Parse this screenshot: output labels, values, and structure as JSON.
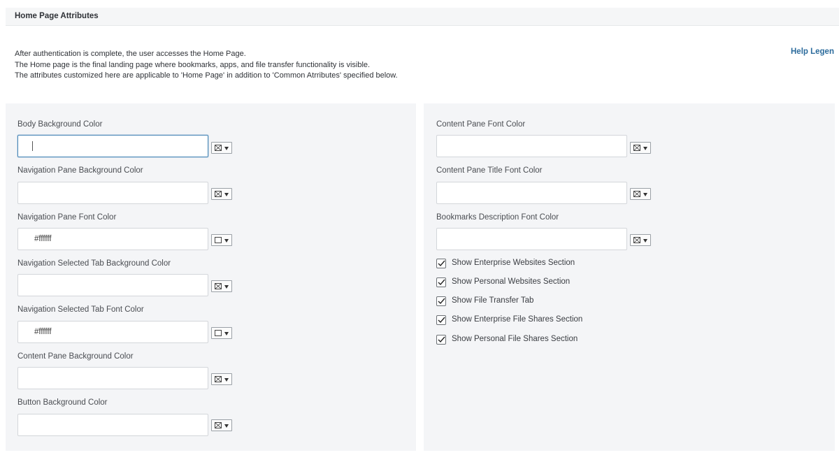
{
  "section": {
    "title": "Home Page Attributes"
  },
  "intro": {
    "lines": [
      "After authentication is complete, the user accesses the Home Page.",
      "The Home page is the final landing page where bookmarks, apps, and file transfer functionality is visible.",
      "The attributes customized here are applicable to 'Home Page' in addition to 'Common Atrributes' specified below."
    ]
  },
  "help_link": "Help Legen",
  "left_fields": [
    {
      "label": "Body Background Color",
      "value": "",
      "swatch": "none",
      "focused": true
    },
    {
      "label": "Navigation Pane Background Color",
      "value": "",
      "swatch": "none"
    },
    {
      "label": "Navigation Pane Font Color",
      "value": "#ffffff",
      "swatch": "#ffffff"
    },
    {
      "label": "Navigation Selected Tab Background Color",
      "value": "",
      "swatch": "none"
    },
    {
      "label": "Navigation Selected Tab Font Color",
      "value": "#ffffff",
      "swatch": "#ffffff"
    },
    {
      "label": "Content Pane Background Color",
      "value": "",
      "swatch": "none"
    },
    {
      "label": "Button Background Color",
      "value": "",
      "swatch": "none"
    }
  ],
  "right_fields": [
    {
      "label": "Content Pane Font Color",
      "value": "",
      "swatch": "none"
    },
    {
      "label": "Content Pane Title Font Color",
      "value": "",
      "swatch": "none"
    },
    {
      "label": "Bookmarks Description Font Color",
      "value": "",
      "swatch": "none"
    }
  ],
  "checkboxes": [
    {
      "label": "Show Enterprise Websites Section",
      "checked": true
    },
    {
      "label": "Show Personal Websites Section",
      "checked": true
    },
    {
      "label": "Show File Transfer Tab",
      "checked": true
    },
    {
      "label": "Show Enterprise File Shares Section",
      "checked": true
    },
    {
      "label": "Show Personal File Shares Section",
      "checked": true
    }
  ],
  "colors": {
    "link": "#2b6b9c",
    "panel_bg": "#f4f5f7",
    "focus_border": "#4b89b8"
  }
}
